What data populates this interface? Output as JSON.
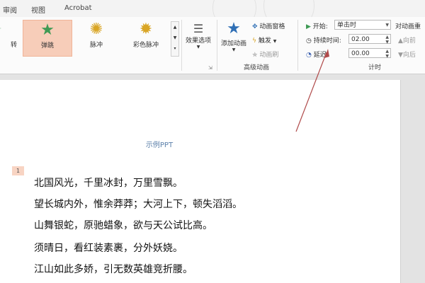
{
  "menu": {
    "tabs": [
      "审阅",
      "视图",
      "Acrobat"
    ]
  },
  "colors": {
    "selected_bg": "#f7cdb9",
    "arrow": "#b04a4a",
    "title": "#5b7fa9"
  },
  "ribbon": {
    "effects": [
      {
        "label": "转",
        "icon": "star-green-icon",
        "glyph": "✦"
      },
      {
        "label": "弹跳",
        "icon": "star-bounce-icon",
        "glyph": "★",
        "selected": true
      },
      {
        "label": "脉冲",
        "icon": "star-pulse-icon",
        "glyph": "✺"
      },
      {
        "label": "彩色脉冲",
        "icon": "star-color-pulse-icon",
        "glyph": "✹"
      }
    ],
    "effect_options_label": "效果选项",
    "add_animation_label": "添加动画",
    "animation_pane_label": "动画窗格",
    "trigger_label": "触发",
    "animation_painter_label": "动画刷",
    "advanced_group_label": "高级动画",
    "timing": {
      "start_label": "开始:",
      "start_value": "单击时",
      "duration_label": "持续时间:",
      "duration_value": "02.00",
      "delay_label": "延迟:",
      "delay_value": "00.00",
      "group_label": "计时",
      "reorder_label": "对动画重",
      "move_earlier": "向前",
      "move_later": "向后"
    }
  },
  "slide": {
    "title": "示例PPT",
    "animation_tag": "1",
    "lines": [
      "北国风光，千里冰封，万里雪飘。",
      "望长城内外，惟余莽莽；大河上下，顿失滔滔。",
      "山舞银蛇，原驰蜡象，欲与天公试比高。",
      "须晴日，看红装素裹，分外妖娆。",
      "江山如此多娇，引无数英雄竞折腰。"
    ]
  }
}
